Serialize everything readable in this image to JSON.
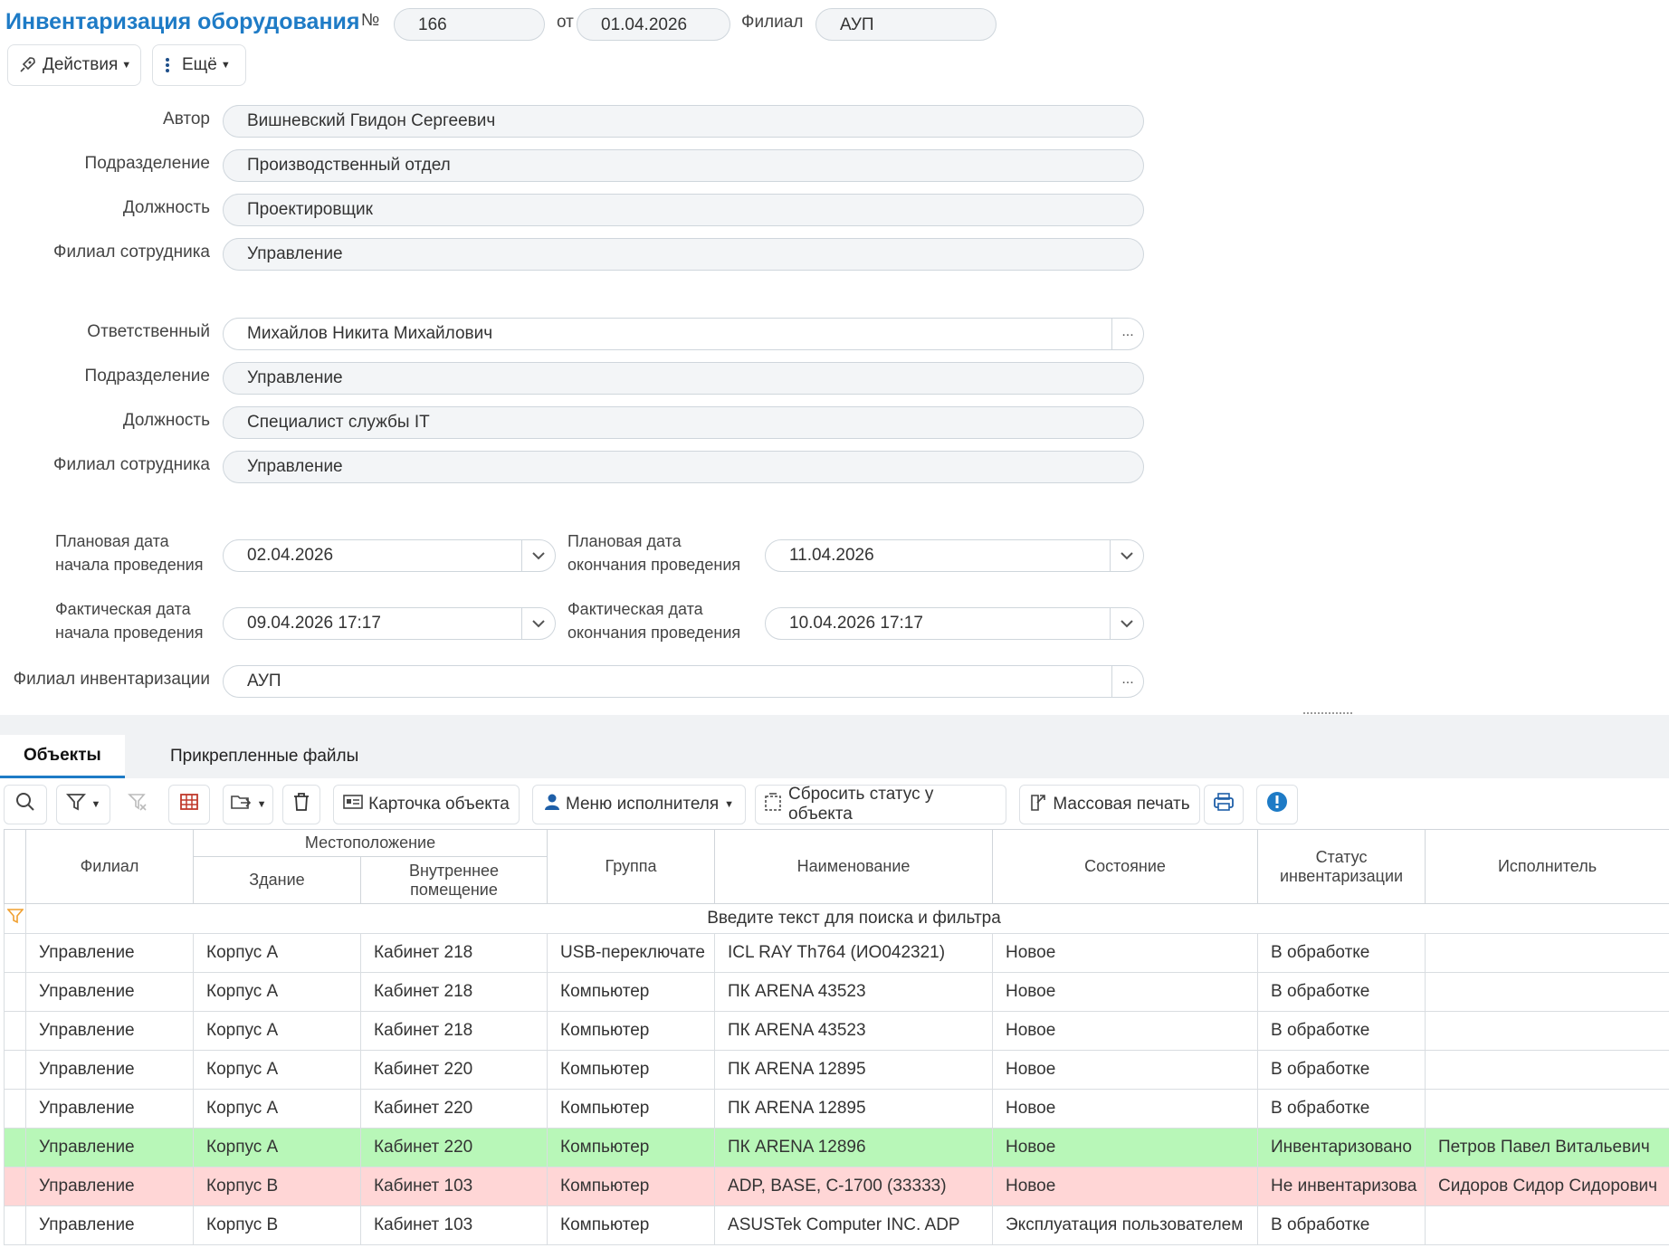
{
  "header": {
    "title": "Инвентаризация оборудования",
    "num_label": "№",
    "num_value": "166",
    "date_label": "от",
    "date_value": "01.04.2026",
    "branch_label": "Филиал",
    "branch_value": "АУП"
  },
  "toolbar": {
    "actions_label": "Действия",
    "more_label": "Ещё"
  },
  "author_block": {
    "author_label": "Автор",
    "author_value": "Вишневский  Гвидон  Сергеевич",
    "division_label": "Подразделение",
    "division_value": "Производственный отдел",
    "position_label": "Должность",
    "position_value": "Проектировщик",
    "branch_label": "Филиал сотрудника",
    "branch_value": "Управление"
  },
  "responsible_block": {
    "responsible_label": "Ответственный",
    "responsible_value": "Михайлов Никита Михайлович",
    "division_label": "Подразделение",
    "division_value": "Управление",
    "position_label": "Должность",
    "position_value": "Специалист службы IT",
    "branch_label": "Филиал сотрудника",
    "branch_value": "Управление"
  },
  "dates": {
    "plan_start_label_1": "Плановая дата",
    "plan_start_label_2": "начала проведения",
    "plan_start_value": "02.04.2026",
    "plan_end_label_1": "Плановая дата",
    "plan_end_label_2": "окончания проведения",
    "plan_end_value": "11.04.2026",
    "fact_start_label_1": "Фактическая дата",
    "fact_start_label_2": "начала проведения",
    "fact_start_value": "09.04.2026 17:17",
    "fact_end_label_1": "Фактическая дата",
    "fact_end_label_2": "окончания проведения",
    "fact_end_value": "10.04.2026 17:17",
    "inv_branch_label": "Филиал инвентаризации",
    "inv_branch_value": "АУП",
    "ellipsis": "..."
  },
  "tabs": [
    "Объекты",
    "Прикрепленные файлы"
  ],
  "grid_toolbar": {
    "card_label": "Карточка объекта",
    "executor_menu_label": "Меню исполнителя",
    "reset_status_label": "Сбросить статус у объекта",
    "mass_print_label": "Массовая печать"
  },
  "grid": {
    "columns": {
      "branch": "Филиал",
      "location": "Местоположение",
      "building": "Здание",
      "room_1": "Внутреннее",
      "room_2": "помещение",
      "group": "Группа",
      "name": "Наименование",
      "state": "Состояние",
      "status_1": "Статус",
      "status_2": "инвентаризации",
      "executor": "Исполнитель"
    },
    "filter_placeholder": "Введите текст для поиска и фильтра",
    "rows": [
      [
        "Управление",
        "Корпус А",
        "Кабинет 218",
        "USB-переключате",
        "ICL RAY Th764 (ИО042321)",
        "Новое",
        "В обработке",
        ""
      ],
      [
        "Управление",
        "Корпус А",
        "Кабинет 218",
        "Компьютер",
        "ПК ARENA 43523",
        "Новое",
        "В обработке",
        ""
      ],
      [
        "Управление",
        "Корпус А",
        "Кабинет 218",
        "Компьютер",
        "ПК ARENA 43523",
        "Новое",
        "В обработке",
        ""
      ],
      [
        "Управление",
        "Корпус А",
        "Кабинет 220",
        "Компьютер",
        "ПК ARENA 12895",
        "Новое",
        "В обработке",
        ""
      ],
      [
        "Управление",
        "Корпус А",
        "Кабинет 220",
        "Компьютер",
        "ПК ARENA 12895",
        "Новое",
        "В обработке",
        ""
      ],
      [
        "Управление",
        "Корпус А",
        "Кабинет 220",
        "Компьютер",
        "ПК ARENA 12896",
        "Новое",
        "Инвентаризовано",
        "Петров Павел Витальевич"
      ],
      [
        "Управление",
        "Корпус В",
        "Кабинет 103",
        "Компьютер",
        "ADP, BASE, C-1700  (33333)",
        "Новое",
        "Не инвентаризова",
        "Сидоров Сидор Сидорович"
      ],
      [
        "Управление",
        "Корпус В",
        "Кабинет 103",
        "Компьютер",
        "ASUSTek Computer INC. ADP",
        "Эксплуатация пользователем",
        "В обработке",
        ""
      ]
    ],
    "row_highlight": [
      "",
      "",
      "",
      "",
      "",
      "green",
      "red",
      ""
    ]
  },
  "colors": {
    "accent": "#1e7bc6",
    "row_green": "#b8f7b8",
    "row_red": "#ffd6d6",
    "info_icon": "#1e7bc6"
  }
}
